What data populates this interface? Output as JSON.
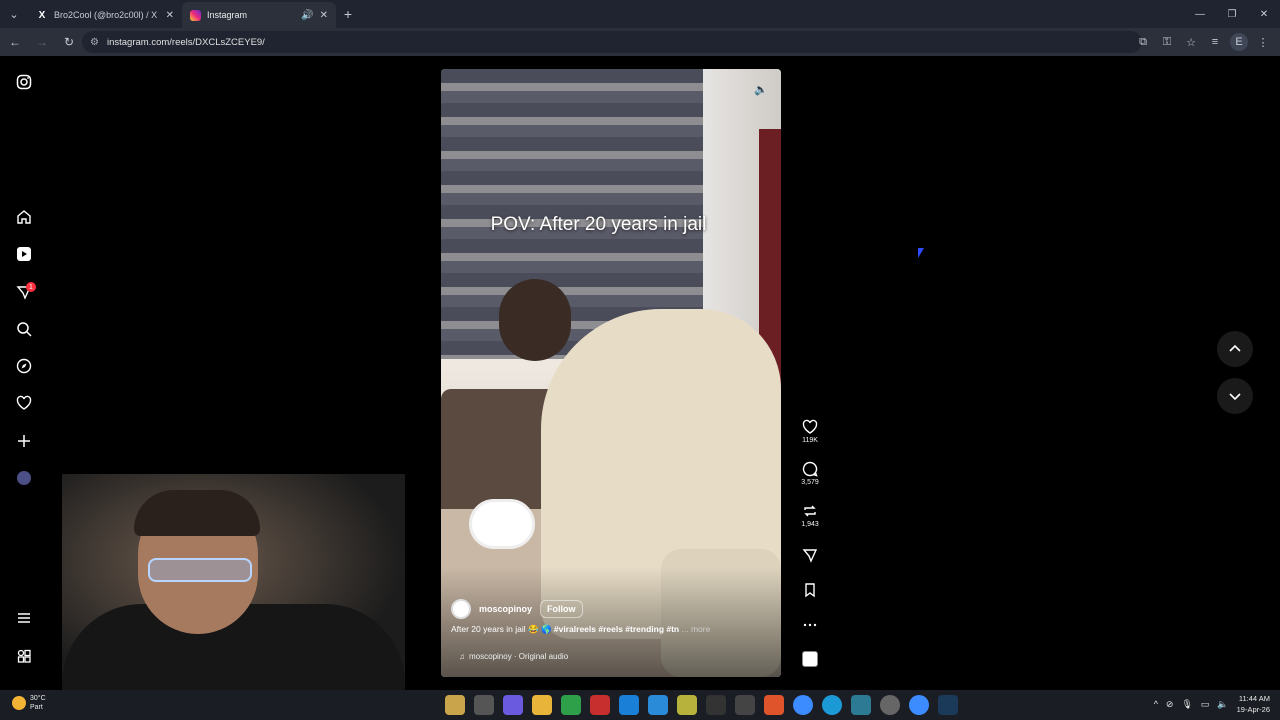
{
  "browser": {
    "tabs": [
      {
        "title": "Bro2Cool (@bro2c00l) / X",
        "icon": "x-logo-icon",
        "active": false
      },
      {
        "title": "Instagram",
        "icon": "instagram-logo-icon",
        "active": true
      }
    ],
    "url": "instagram.com/reels/DXCLsZCEYE9/"
  },
  "sidebar": {
    "items": [
      "home-icon",
      "reels-icon",
      "direct-messages-icon",
      "search-icon",
      "explore-icon",
      "notifications-icon",
      "create-icon",
      "profile-avatar",
      "more-menu-icon",
      "meta-apps-icon"
    ],
    "notification_badge": "1"
  },
  "reel": {
    "overlay_text": "POV: After 20 years in jail",
    "owner": "moscopinoy",
    "follow_label": "Follow",
    "caption": "After 20 years in jail 😂 🌎",
    "hashtags": "#viralreels #reels #trending #tn",
    "more_label": "... more",
    "audio": "moscopinoy · Original audio"
  },
  "actions": {
    "likes": "119K",
    "comments": "3,579",
    "reposts": "1,943"
  },
  "taskbar": {
    "temperature": "30°C",
    "weather_note": "Part",
    "time": "11:44 AM",
    "date": "19-Apr-26"
  },
  "colors": {
    "badge": "#ff3040",
    "chrome_bg": "#1f2430",
    "accent_cursor": "#2c4bff"
  }
}
